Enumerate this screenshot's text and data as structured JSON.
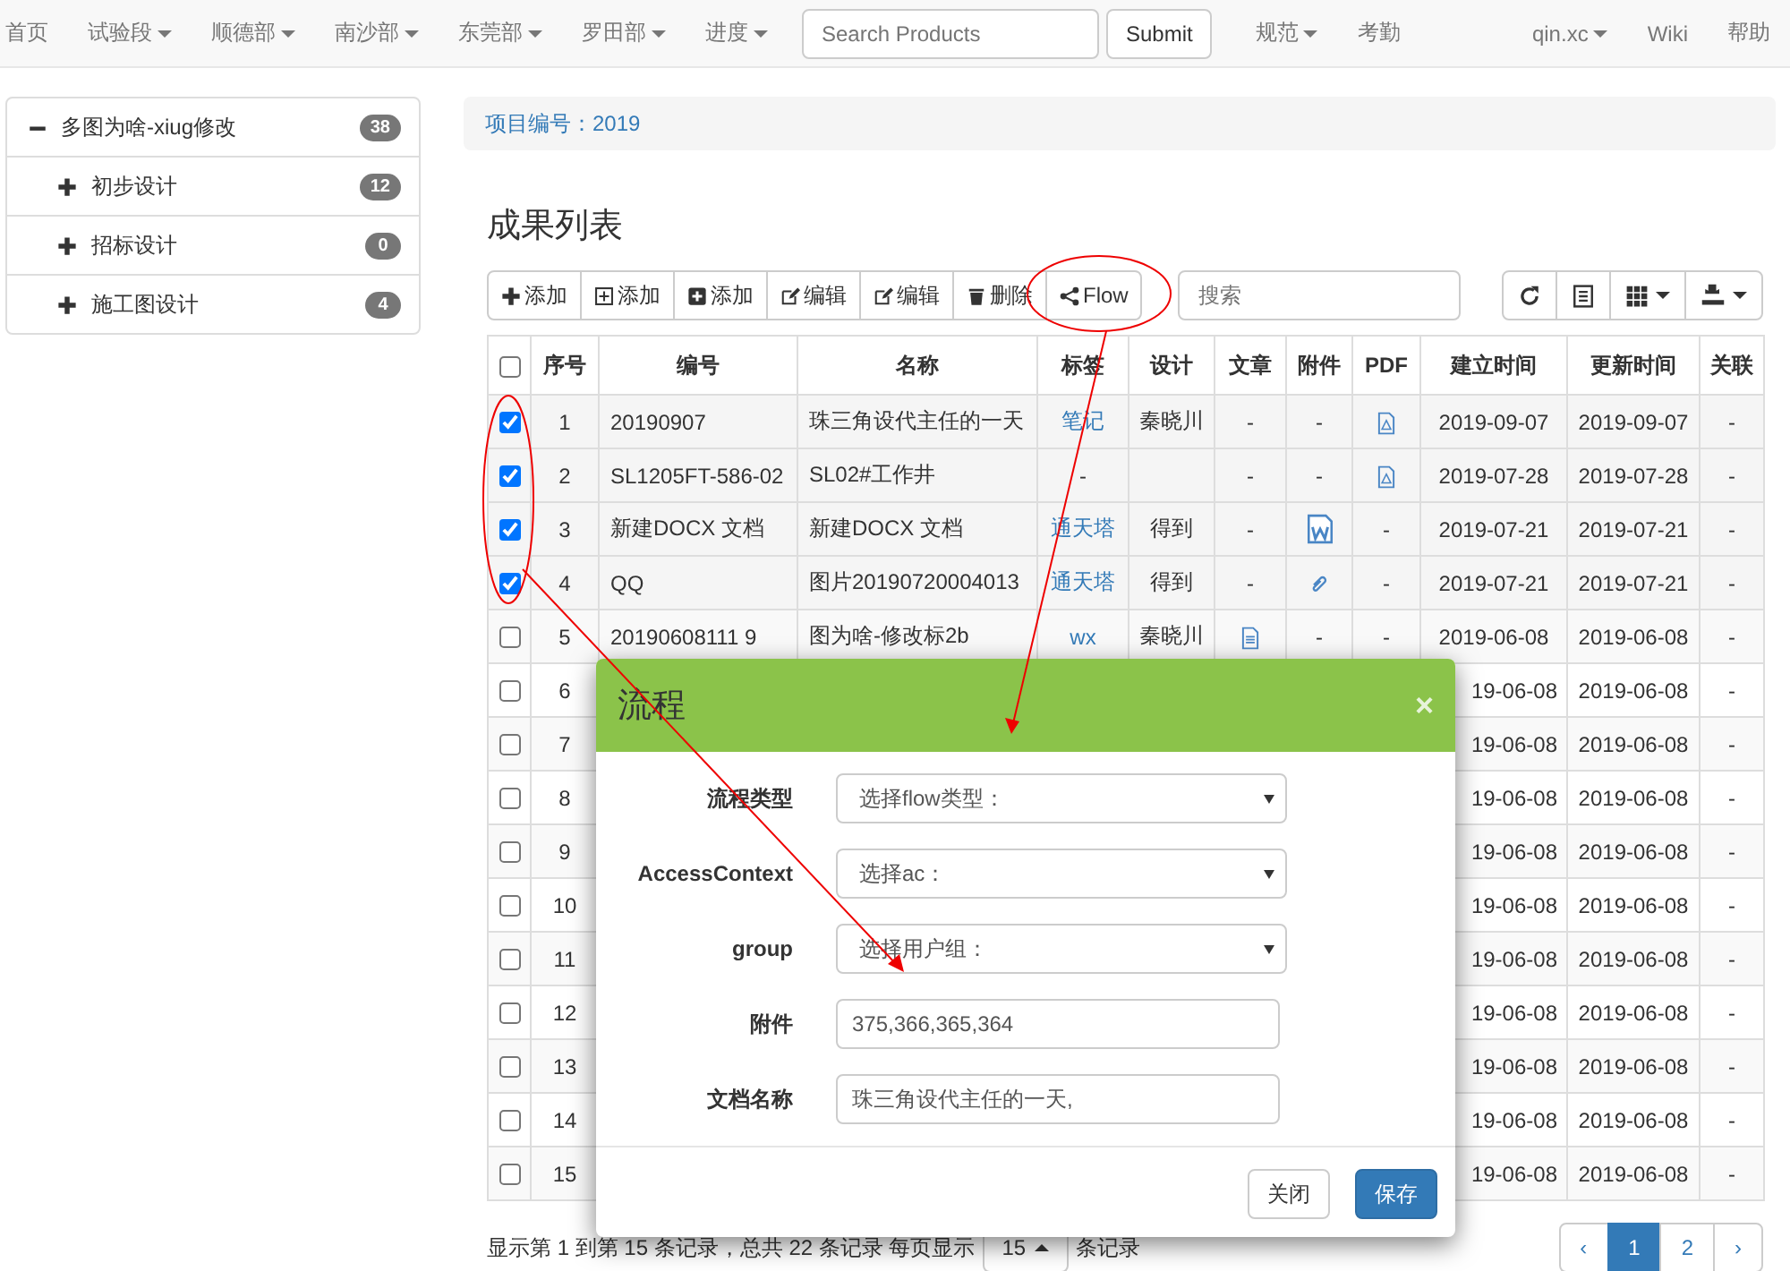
{
  "navbar": {
    "items": [
      {
        "label": "首页",
        "dropdown": false
      },
      {
        "label": "试验段",
        "dropdown": true
      },
      {
        "label": "顺德部",
        "dropdown": true
      },
      {
        "label": "南沙部",
        "dropdown": true
      },
      {
        "label": "东莞部",
        "dropdown": true
      },
      {
        "label": "罗田部",
        "dropdown": true
      },
      {
        "label": "进度",
        "dropdown": true
      }
    ],
    "search": {
      "placeholder": "Search Products",
      "button": "Submit"
    },
    "items_after": [
      {
        "label": "规范",
        "dropdown": true
      },
      {
        "label": "考勤",
        "dropdown": false
      }
    ],
    "right_items": [
      {
        "label": "qin.xc",
        "dropdown": true
      },
      {
        "label": "Wiki",
        "dropdown": false
      },
      {
        "label": "帮助",
        "dropdown": false
      }
    ]
  },
  "sidebar": {
    "tree": [
      {
        "label": "多图为啥-xiug修改",
        "count": "38",
        "expanded": true,
        "children": [
          {
            "label": "初步设计",
            "count": "12",
            "expanded": false
          },
          {
            "label": "招标设计",
            "count": "0",
            "expanded": false
          },
          {
            "label": "施工图设计",
            "count": "4",
            "expanded": false
          }
        ]
      }
    ]
  },
  "breadcrumb": "项目编号：2019",
  "title": "成果列表",
  "toolbar": {
    "buttons": [
      {
        "kind": "add",
        "label": "添加"
      },
      {
        "kind": "add-table",
        "label": "添加"
      },
      {
        "kind": "add-square",
        "label": "添加"
      },
      {
        "kind": "edit",
        "label": "编辑"
      },
      {
        "kind": "edit",
        "label": "编辑"
      },
      {
        "kind": "delete",
        "label": "删除"
      },
      {
        "kind": "share",
        "label": "Flow"
      }
    ],
    "search_placeholder": "搜索",
    "right_buttons": [
      {
        "kind": "refresh",
        "dropdown": false
      },
      {
        "kind": "list",
        "dropdown": false
      },
      {
        "kind": "grid",
        "dropdown": true
      },
      {
        "kind": "export",
        "dropdown": true
      }
    ]
  },
  "table": {
    "select_all_checked": false,
    "columns": [
      "序号",
      "编号",
      "名称",
      "标签",
      "设计",
      "文章",
      "附件",
      "PDF",
      "建立时间",
      "更新时间",
      "关联"
    ],
    "rows": [
      {
        "kind": "full",
        "selected": true,
        "seq": "1",
        "code": "20190907",
        "name": "珠三角设代主任的一天",
        "tag": "笔记",
        "designer": "秦晓川",
        "article": "-",
        "attachment": "-",
        "pdf": {
          "kind": "pdf"
        },
        "created": "2019-09-07",
        "updated": "2019-09-07",
        "related": "-"
      },
      {
        "kind": "full",
        "selected": true,
        "seq": "2",
        "code": "SL1205FT-586-02",
        "name": "SL02#工作井",
        "tag": "-",
        "article": "-",
        "attachment": "-",
        "pdf": {
          "kind": "pdf"
        },
        "created": "2019-07-28",
        "updated": "2019-07-28",
        "related": "-"
      },
      {
        "kind": "full",
        "selected": true,
        "seq": "3",
        "code": "新建DOCX 文档",
        "name": "新建DOCX 文档",
        "tag": "通天塔",
        "designer": "得到",
        "article": "-",
        "attachment": {
          "kind": "word"
        },
        "pdf": "-",
        "created": "2019-07-21",
        "updated": "2019-07-21",
        "related": "-"
      },
      {
        "kind": "full",
        "selected": true,
        "seq": "4",
        "code": "QQ",
        "name": "图片20190720004013",
        "tag": "通天塔",
        "designer": "得到",
        "article": "-",
        "attachment": {
          "kind": "clip"
        },
        "pdf": "-",
        "created": "2019-07-21",
        "updated": "2019-07-21",
        "related": "-"
      },
      {
        "kind": "full",
        "selected": false,
        "seq": "5",
        "code": "20190608111 9",
        "name": "图为啥-修改标2b",
        "tag": "wx",
        "designer": "秦晓川",
        "article": {
          "kind": "file"
        },
        "attachment": "-",
        "pdf": "-",
        "created": "2019-06-08",
        "updated": "2019-06-08",
        "related": "-"
      },
      {
        "kind": "covered",
        "selected": false,
        "seq": "6",
        "created": "19-06-08",
        "updated": "2019-06-08",
        "related": "-"
      },
      {
        "kind": "covered",
        "selected": false,
        "seq": "7",
        "created": "19-06-08",
        "updated": "2019-06-08",
        "related": "-"
      },
      {
        "kind": "covered",
        "selected": false,
        "seq": "8",
        "created": "19-06-08",
        "updated": "2019-06-08",
        "related": "-"
      },
      {
        "kind": "covered",
        "selected": false,
        "seq": "9",
        "created": "19-06-08",
        "updated": "2019-06-08",
        "related": "-"
      },
      {
        "kind": "covered",
        "selected": false,
        "seq": "10",
        "created": "19-06-08",
        "updated": "2019-06-08",
        "related": "-"
      },
      {
        "kind": "covered",
        "selected": false,
        "seq": "11",
        "created": "19-06-08",
        "updated": "2019-06-08",
        "related": "-"
      },
      {
        "kind": "covered",
        "selected": false,
        "seq": "12",
        "created": "19-06-08",
        "updated": "2019-06-08",
        "related": "-"
      },
      {
        "kind": "covered",
        "selected": false,
        "seq": "13",
        "created": "19-06-08",
        "updated": "2019-06-08",
        "related": "-"
      },
      {
        "kind": "covered",
        "selected": false,
        "seq": "14",
        "created": "19-06-08",
        "updated": "2019-06-08",
        "related": "-"
      },
      {
        "kind": "covered",
        "selected": false,
        "seq": "15",
        "created": "19-06-08",
        "updated": "2019-06-08",
        "related": "-"
      }
    ]
  },
  "footer": {
    "text_before": "显示第 1 到第 15 条记录，总共 22 条记录 每页显示",
    "page_size": "15",
    "text_after": "条记录"
  },
  "pagination": {
    "prev": "‹",
    "pages": [
      {
        "label": "1",
        "selected": true
      },
      {
        "label": "2",
        "selected": false
      }
    ],
    "next": "›"
  },
  "modal": {
    "title": "流程",
    "close": "×",
    "fields": [
      {
        "kind": "select",
        "label": "流程类型",
        "value": "选择flow类型："
      },
      {
        "kind": "select",
        "label": "AccessContext",
        "value": "选择ac："
      },
      {
        "kind": "select",
        "label": "group",
        "value": "选择用户组："
      },
      {
        "kind": "input",
        "label": "附件",
        "value": "375,366,365,364"
      },
      {
        "kind": "input",
        "label": "文档名称",
        "value": "珠三角设代主任的一天,"
      }
    ],
    "buttons": [
      {
        "kind": "default",
        "label": "关闭"
      },
      {
        "kind": "primary",
        "label": "保存"
      }
    ]
  }
}
